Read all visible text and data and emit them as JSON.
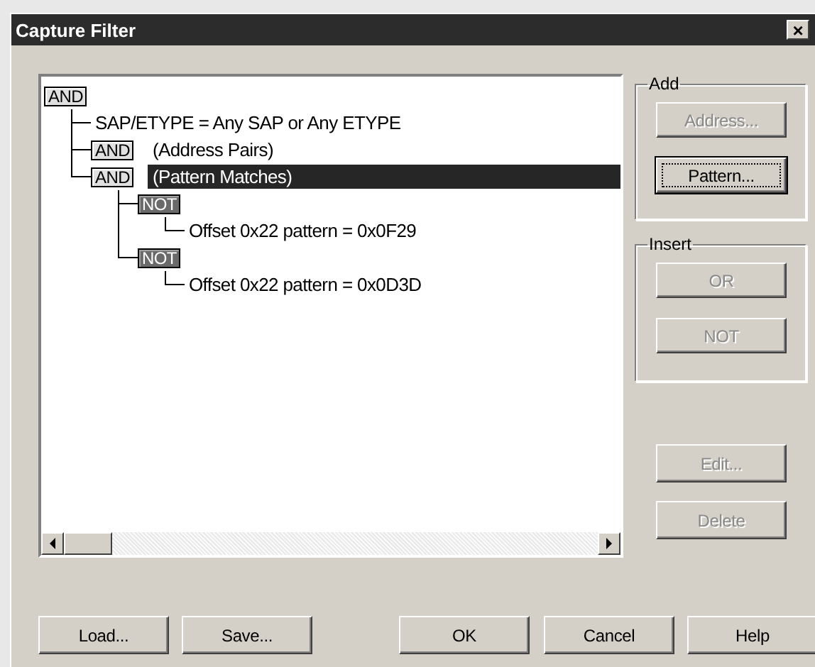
{
  "window": {
    "title": "Capture Filter",
    "close": "×"
  },
  "tree": [
    {
      "kind": "and",
      "badge": "AND",
      "selected": false,
      "children": [
        {
          "kind": "condition",
          "text": "SAP/ETYPE = Any SAP or Any ETYPE",
          "selected": false
        },
        {
          "kind": "and",
          "badge": "AND",
          "text": "(Address Pairs)",
          "selected": false
        },
        {
          "kind": "and",
          "badge": "AND",
          "text": "(Pattern Matches)",
          "selected": true,
          "children": [
            {
              "kind": "not",
              "badge": "NOT",
              "selected": false,
              "children": [
                {
                  "kind": "condition",
                  "text": "Offset 0x22 pattern = 0x0F29",
                  "selected": false
                }
              ]
            },
            {
              "kind": "not",
              "badge": "NOT",
              "selected": false,
              "children": [
                {
                  "kind": "condition",
                  "text": "Offset 0x22 pattern = 0x0D3D",
                  "selected": false
                }
              ]
            }
          ]
        }
      ]
    }
  ],
  "add_group": {
    "title": "Add",
    "buttons": [
      {
        "label": "Address...",
        "disabled": true,
        "default": false
      },
      {
        "label": "Pattern...",
        "disabled": false,
        "default": true
      }
    ]
  },
  "insert_group": {
    "title": "Insert",
    "buttons": [
      {
        "label": "OR",
        "disabled": true,
        "default": false
      },
      {
        "label": "NOT",
        "disabled": true,
        "default": false
      }
    ]
  },
  "side_buttons": [
    {
      "label": "Edit...",
      "disabled": true,
      "default": false
    },
    {
      "label": "Delete",
      "disabled": true,
      "default": false
    }
  ],
  "footer_buttons": [
    {
      "label": "Load...",
      "disabled": false,
      "default": false
    },
    {
      "label": "Save...",
      "disabled": false,
      "default": false
    },
    {
      "label": "OK",
      "disabled": false,
      "default": false
    },
    {
      "label": "Cancel",
      "disabled": false,
      "default": false
    },
    {
      "label": "Help",
      "disabled": false,
      "default": false
    }
  ]
}
